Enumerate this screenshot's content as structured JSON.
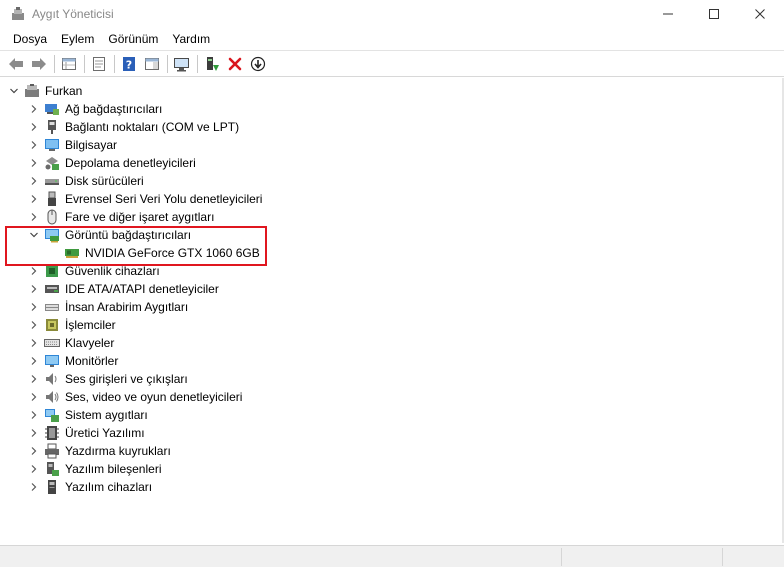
{
  "window": {
    "title": "Aygıt Yöneticisi",
    "controls": {
      "minimize": "—",
      "maximize": "☐",
      "close": "✕"
    }
  },
  "menu": [
    "Dosya",
    "Eylem",
    "Görünüm",
    "Yardım"
  ],
  "toolbar": {
    "icons": [
      "back-arrow-icon",
      "forward-arrow-icon",
      "properties-grid-icon",
      "show-hidden-icon",
      "help-icon",
      "action-pane-icon",
      "scan-hardware-icon",
      "update-driver-icon",
      "uninstall-device-icon",
      "disable-device-icon"
    ]
  },
  "tree": {
    "root": "Furkan",
    "categories": [
      {
        "label": "Ağ bağdaştırıcıları",
        "icon": "network-adapter-icon",
        "expanded": false
      },
      {
        "label": "Bağlantı noktaları (COM ve LPT)",
        "icon": "port-icon",
        "expanded": false
      },
      {
        "label": "Bilgisayar",
        "icon": "computer-icon",
        "expanded": false
      },
      {
        "label": "Depolama denetleyicileri",
        "icon": "storage-controller-icon",
        "expanded": false
      },
      {
        "label": "Disk sürücüleri",
        "icon": "disk-drive-icon",
        "expanded": false
      },
      {
        "label": "Evrensel Seri Veri Yolu denetleyicileri",
        "icon": "usb-icon",
        "expanded": false
      },
      {
        "label": "Fare ve diğer işaret aygıtları",
        "icon": "mouse-icon",
        "expanded": false
      },
      {
        "label": "Görüntü bağdaştırıcıları",
        "icon": "display-adapter-icon",
        "expanded": true,
        "children": [
          {
            "label": "NVIDIA GeForce GTX 1060 6GB",
            "icon": "display-adapter-icon"
          }
        ]
      },
      {
        "label": "Güvenlik cihazları",
        "icon": "security-device-icon",
        "expanded": false
      },
      {
        "label": "IDE ATA/ATAPI denetleyiciler",
        "icon": "ide-controller-icon",
        "expanded": false
      },
      {
        "label": "İnsan Arabirim Aygıtları",
        "icon": "hid-icon",
        "expanded": false
      },
      {
        "label": "İşlemciler",
        "icon": "processor-icon",
        "expanded": false
      },
      {
        "label": "Klavyeler",
        "icon": "keyboard-icon",
        "expanded": false
      },
      {
        "label": "Monitörler",
        "icon": "monitor-icon",
        "expanded": false
      },
      {
        "label": "Ses girişleri ve çıkışları",
        "icon": "audio-io-icon",
        "expanded": false
      },
      {
        "label": "Ses, video ve oyun denetleyicileri",
        "icon": "sound-controller-icon",
        "expanded": false
      },
      {
        "label": "Sistem aygıtları",
        "icon": "system-device-icon",
        "expanded": false
      },
      {
        "label": "Üretici Yazılımı",
        "icon": "firmware-icon",
        "expanded": false
      },
      {
        "label": "Yazdırma kuyrukları",
        "icon": "print-queue-icon",
        "expanded": false
      },
      {
        "label": "Yazılım bileşenleri",
        "icon": "software-component-icon",
        "expanded": false
      },
      {
        "label": "Yazılım cihazları",
        "icon": "software-device-icon",
        "expanded": false
      }
    ]
  },
  "colors": {
    "highlight_border": "#e0161f",
    "accent_blue": "#1e73c8",
    "uninstall_red": "#d9161e",
    "scan_green": "#2f9a3a"
  }
}
